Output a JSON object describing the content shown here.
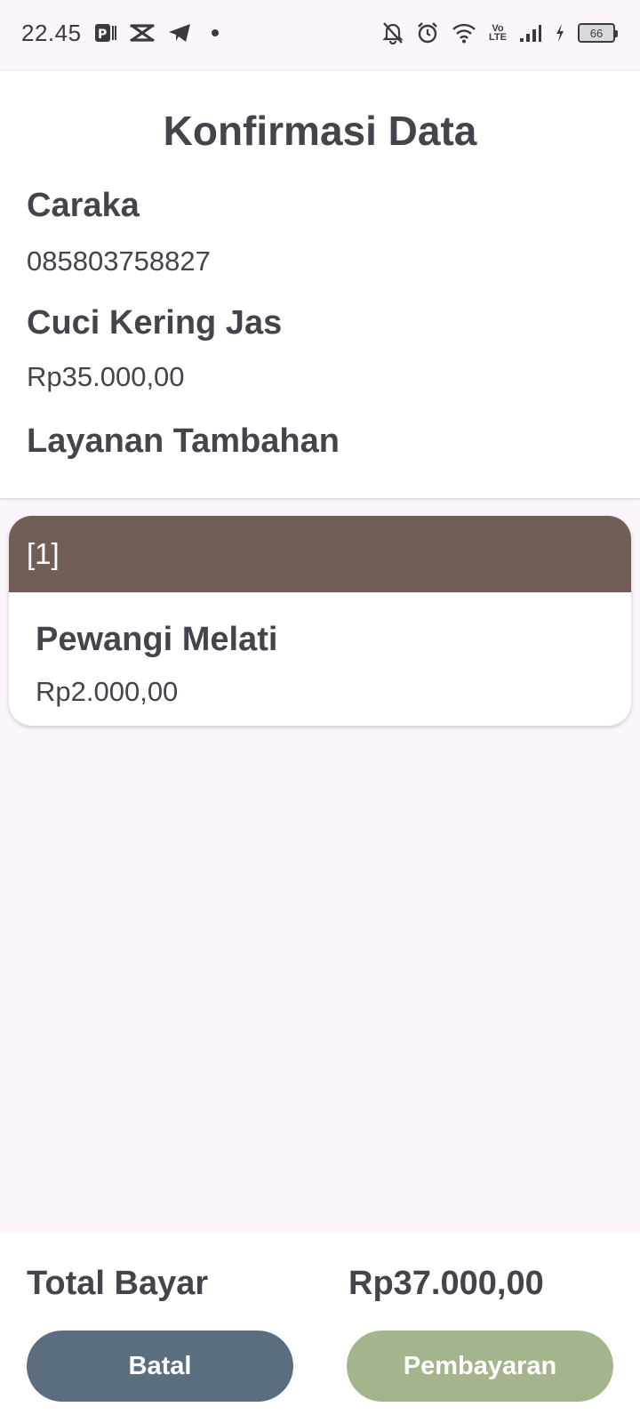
{
  "status_bar": {
    "time": "22.45",
    "volte_top": "Vo",
    "volte_bottom": "LTE",
    "battery": "66"
  },
  "page_title": "Konfirmasi Data",
  "customer": {
    "name": "Caraka",
    "phone": "085803758827"
  },
  "service": {
    "name": "Cuci Kering Jas",
    "price": "Rp35.000,00"
  },
  "addons_heading": "Layanan Tambahan",
  "addons": [
    {
      "header": "[1]",
      "name": "Pewangi Melati",
      "price": "Rp2.000,00"
    }
  ],
  "total": {
    "label": "Total Bayar",
    "value": "Rp37.000,00"
  },
  "buttons": {
    "cancel": "Batal",
    "pay": "Pembayaran"
  },
  "colors": {
    "background": "#fcf5fc",
    "addon_header": "#715e55",
    "cancel_button": "#5b6e80",
    "pay_button": "#a4b48d",
    "text": "#45444c"
  }
}
